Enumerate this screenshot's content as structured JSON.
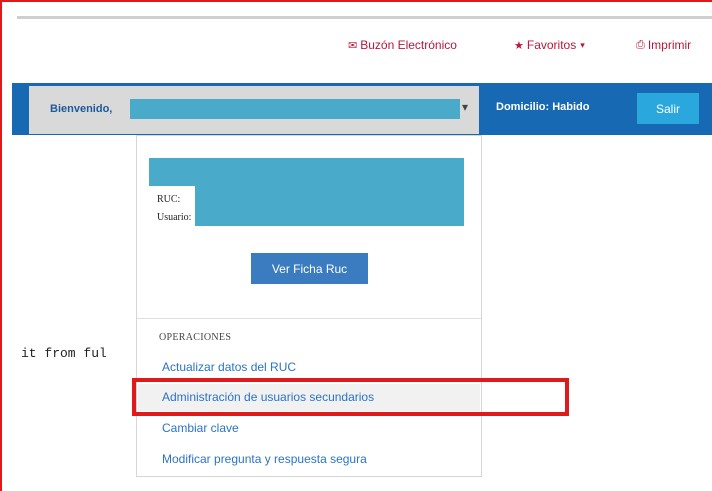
{
  "topnav": {
    "buzon_label": "Buzón Electrónico",
    "favoritos_label": "Favoritos",
    "imprimir_label": "Imprimir"
  },
  "header": {
    "welcome_label": "Bienvenido,",
    "domicilio_label": "Domicilio: Habido",
    "sair_label": "Salir"
  },
  "profile": {
    "ruc_label": "RUC:",
    "usuario_label": "Usuario:",
    "ver_ficha_label": "Ver Ficha Ruc"
  },
  "operations": {
    "title": "OPERACIONES",
    "items": [
      {
        "label": "Actualizar datos del RUC"
      },
      {
        "label": "Administración de usuarios secundarios"
      },
      {
        "label": "Cambiar clave"
      },
      {
        "label": "Modificar pregunta y respuesta segura"
      }
    ]
  },
  "background_text": "it from ful",
  "colors": {
    "header_blue": "#1769b4",
    "redaction_blue": "#49aac9",
    "button_blue": "#3b7bbf",
    "highlight_red": "#e01a1a",
    "link_blue": "#2a73c6"
  }
}
